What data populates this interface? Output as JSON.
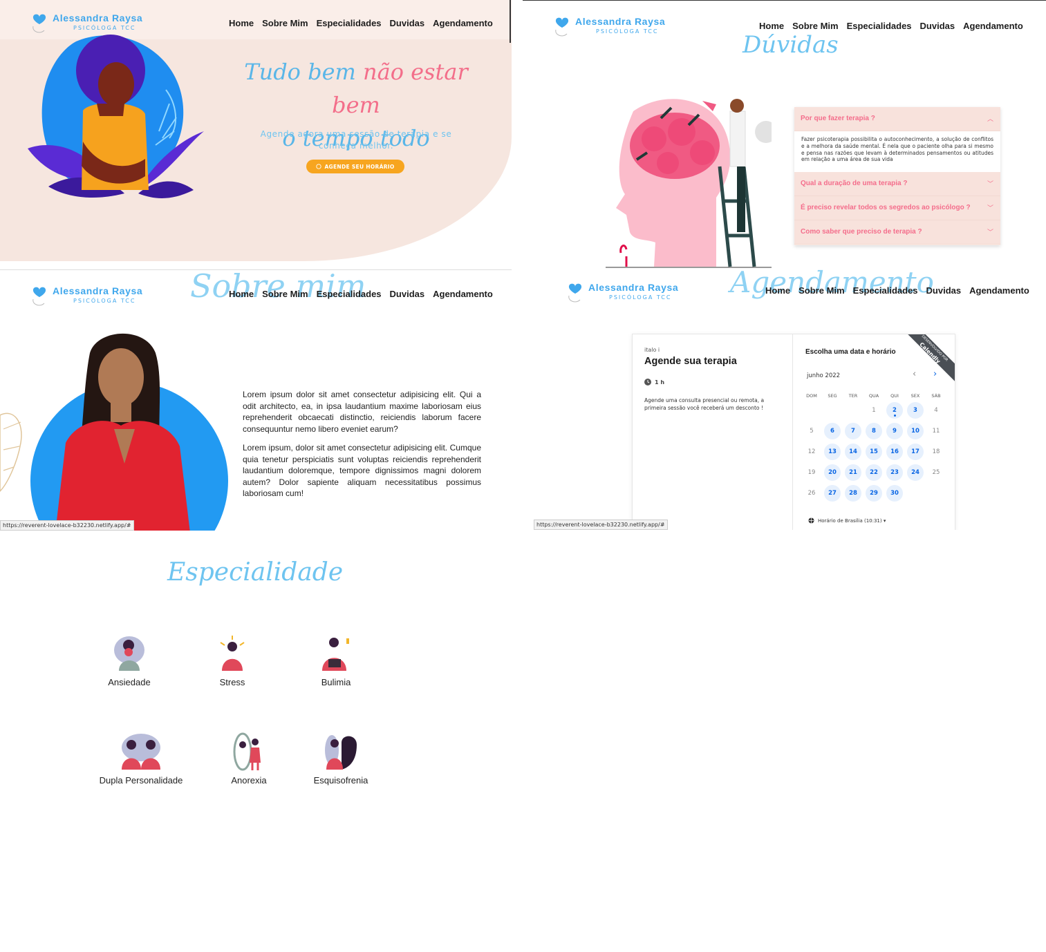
{
  "brand": {
    "name": "Alessandra Raysa",
    "subtitle": "PSICÓLOGA TCC"
  },
  "nav": {
    "home": "Home",
    "sobre": "Sobre Mim",
    "especialidades": "Especialidades",
    "duvidas": "Duvidas",
    "agendamento": "Agendamento"
  },
  "hero": {
    "title_part1": "Tudo bem ",
    "title_part2": "não estar bem",
    "title_part3": "o tempo todo",
    "subtitle": "Agende agora uma sessão de terapia e se conheça melhor.",
    "cta": "AGENDE SEU HORÁRIO"
  },
  "duvidas": {
    "title": "Dúvidas",
    "items": [
      {
        "q": "Por que fazer terapia ?",
        "a": "Fazer psicoterapia possibilita o autoconhecimento, a solução de conflitos e a melhora da saúde mental. É nela que o paciente olha para si mesmo e pensa nas razões que levam à determinados pensamentos ou atitudes em relação a uma área de sua vida"
      },
      {
        "q": "Qual a duração de uma terapia ?"
      },
      {
        "q": "É preciso revelar todos os segredos ao psicólogo ?"
      },
      {
        "q": "Como saber que preciso de terapia ?"
      }
    ]
  },
  "sobre": {
    "title": "Sobre mim",
    "p1": "Lorem ipsum dolor sit amet consectetur adipisicing elit. Qui a odit architecto, ea, in ipsa laudantium maxime laboriosam eius reprehenderit obcaecati distinctio, reiciendis laborum facere consequuntur nemo libero eveniet earum?",
    "p2": "Lorem ipsum, dolor sit amet consectetur adipisicing elit. Cumque quia tenetur perspiciatis sunt voluptas reiciendis reprehenderit laudantium doloremque, tempore dignissimos magni dolorem autem? Dolor sapiente aliquam necessitatibus possimus laboriosam cum!",
    "status_url": "https://reverent-lovelace-b32230.netlify.app/#"
  },
  "agendamento": {
    "title": "Agendamento",
    "host": "italo i",
    "event": "Agende sua terapia",
    "duration": "1 h",
    "description": "Agende uma consulta presencial ou remota, a primeira sessão você receberá um desconto !",
    "choose": "Escolha uma data e horário",
    "month": "junho 2022",
    "weekdays": [
      "DOM",
      "SEG",
      "TER",
      "QUA",
      "QUI",
      "SEX",
      "SÁB"
    ],
    "timezone": "Horário de Brasília (10:31) ▾",
    "ribbon_small": "DESENVOLVIDO POR",
    "ribbon": "Calendly",
    "status_url": "https://reverent-lovelace-b32230.netlify.app/#"
  },
  "especialidade": {
    "title": "Especialidade",
    "items": [
      "Ansiedade",
      "Stress",
      "Bulimia",
      "Dupla Personalidade",
      "Anorexia",
      "Esquisofrenia"
    ]
  },
  "colors": {
    "blue": "#3fa7ec",
    "pink": "#f36e8a",
    "orange": "#f7a51f",
    "calendar_blue": "#0a66e4"
  }
}
